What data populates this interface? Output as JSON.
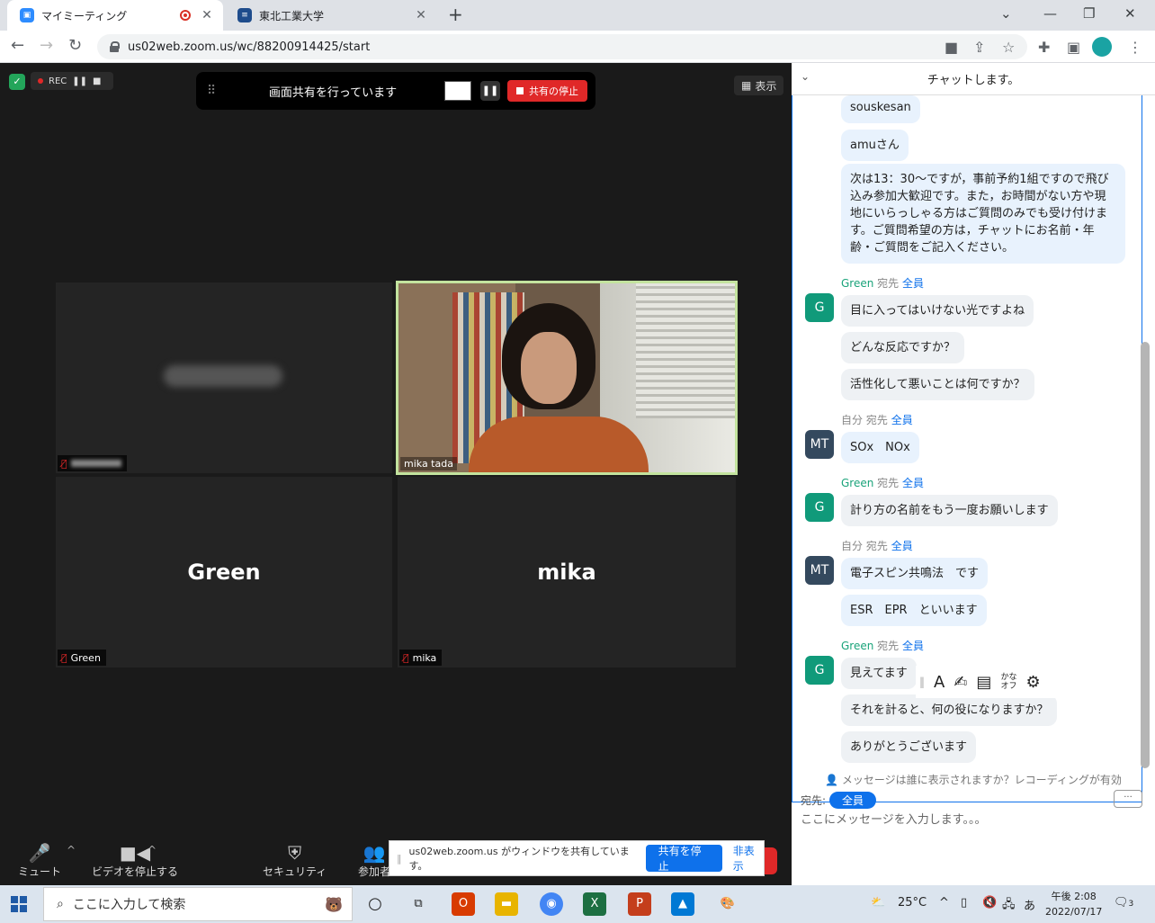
{
  "browser": {
    "tabs": [
      {
        "title": "マイミーティング",
        "active": true
      },
      {
        "title": "東北工業大学",
        "active": false
      }
    ],
    "url": "us02web.zoom.us/wc/88200914425/start"
  },
  "zoom": {
    "rec_label": "REC",
    "share_status": "画面共有を行っています",
    "stop_share_label": "共有の停止",
    "view_label": "表示",
    "tiles": [
      {
        "name": "",
        "big": ""
      },
      {
        "name": "mika tada",
        "big": ""
      },
      {
        "name": "Green",
        "big": "Green"
      },
      {
        "name": "mika",
        "big": "mika"
      }
    ],
    "toolbar": {
      "mute": "ミュート",
      "video": "ビデオを停止する",
      "security": "セキュリティ",
      "participants": "参加者"
    },
    "share_notice": {
      "text": "us02web.zoom.us がウィンドウを共有しています。",
      "stop": "共有を停止",
      "hide": "非表示"
    }
  },
  "chat": {
    "title": "チャットします。",
    "messages": [
      {
        "text": "souskesan"
      },
      {
        "text": "amuさん"
      },
      {
        "text": "次は13：30～ですが，事前予約1組ですので飛び込み参加大歓迎です。また，お時間がない方や現地にいらっしゃる方はご質問のみでも受け付けます。ご質問希望の方は，チャットにお名前・年齢・ご質問をご記入ください。"
      }
    ],
    "groups": [
      {
        "sender": "Green",
        "to_word": "宛先",
        "to": "全員",
        "avatar": "G",
        "messages": [
          "目に入ってはいけない光ですよね",
          "どんな反応ですか？",
          "活性化して悪いことは何ですか？"
        ]
      },
      {
        "sender": "自分",
        "to_word": "宛先",
        "to": "全員",
        "avatar": "MT",
        "messages": [
          "SOx　NOx"
        ]
      },
      {
        "sender": "Green",
        "to_word": "宛先",
        "to": "全員",
        "avatar": "G",
        "messages": [
          "計り方の名前をもう一度お願いします"
        ]
      },
      {
        "sender": "自分",
        "to_word": "宛先",
        "to": "全員",
        "avatar": "MT",
        "messages": [
          "電子スピン共鳴法　です",
          "ESR　EPR　といいます"
        ]
      },
      {
        "sender": "Green",
        "to_word": "宛先",
        "to": "全員",
        "avatar": "G",
        "messages": [
          "見えてます",
          "それを計ると、何の役になりますか？",
          "ありがとうございます"
        ]
      }
    ],
    "float_toolbar": {
      "kana": "かな\nオフ"
    },
    "privacy": "メッセージは誰に表示されますか？レコーディングが有効",
    "recipient_label": "宛先:",
    "recipient": "全員",
    "more": "···",
    "input_placeholder": "ここにメッセージを入力します。。。"
  },
  "taskbar": {
    "search_placeholder": "ここに入力して検索",
    "temperature": "25°C",
    "ime": "あ",
    "time": "午後 2:08",
    "date": "2022/07/17",
    "notifications": "3"
  }
}
